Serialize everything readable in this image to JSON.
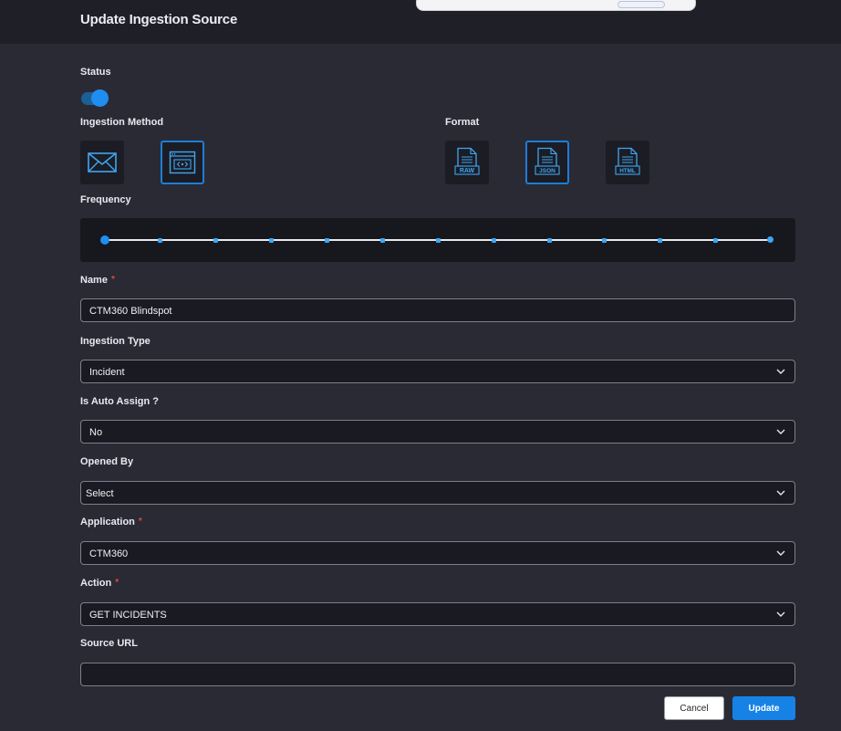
{
  "dialog": {
    "title": "Update Ingestion Source"
  },
  "status": {
    "label": "Status",
    "enabled": true
  },
  "ingestion_method": {
    "label": "Ingestion Method",
    "options": [
      {
        "icon": "envelope-icon",
        "selected": false
      },
      {
        "icon": "api-window-icon",
        "selected": true
      }
    ]
  },
  "format": {
    "label": "Format",
    "options": [
      {
        "text": "RAW",
        "icon": "raw-file-icon",
        "selected": false
      },
      {
        "text": "JSON",
        "icon": "json-file-icon",
        "selected": true
      },
      {
        "text": "HTML",
        "icon": "html-file-icon",
        "selected": false
      }
    ]
  },
  "frequency": {
    "label": "Frequency",
    "steps": 13,
    "selected_index": 0
  },
  "form": {
    "name": {
      "label": "Name",
      "required": true,
      "value": "CTM360 Blindspot"
    },
    "ingestion_type": {
      "label": "Ingestion Type",
      "value": "Incident"
    },
    "auto_assign": {
      "label": "Is Auto Assign ?",
      "value": "No"
    },
    "opened_by": {
      "label": "Opened By",
      "value": "Select"
    },
    "application": {
      "label": "Application",
      "required": true,
      "value": "CTM360"
    },
    "action": {
      "label": "Action",
      "required": true,
      "value": "GET INCIDENTS"
    },
    "source_url": {
      "label": "Source URL",
      "value": ""
    }
  },
  "required_marker": "*",
  "actions": {
    "cancel_label": "Cancel",
    "update_label": "Update"
  },
  "colors": {
    "accent": "#1e8ef0",
    "panel": "#2a2a35",
    "header": "#1f1f28",
    "required": "#e2483d"
  }
}
